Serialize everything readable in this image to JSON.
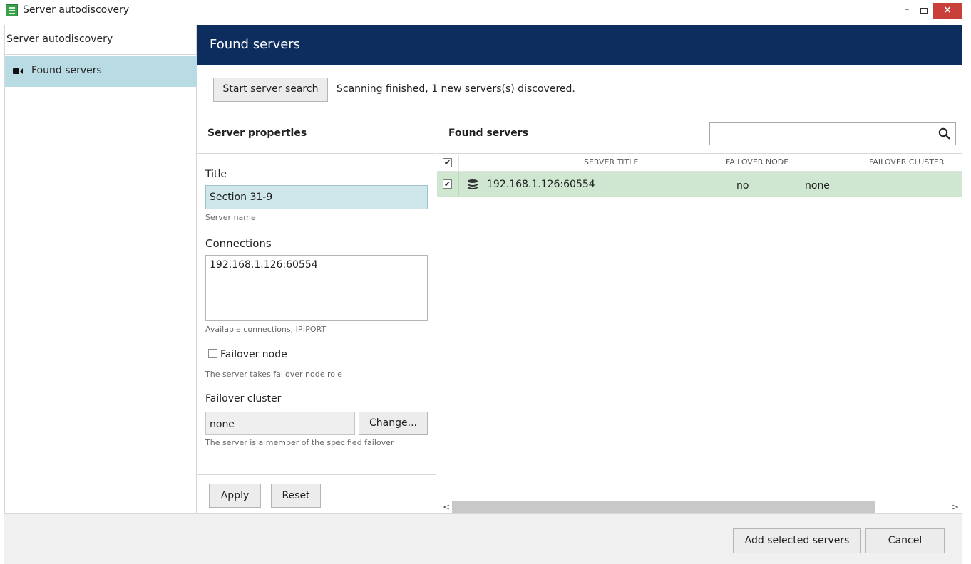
{
  "window": {
    "title": "Server autodiscovery",
    "minimize_label": "–",
    "close_label": "×",
    "close_color": "#c9403a"
  },
  "sidebar": {
    "header": "Server autodiscovery",
    "items": [
      {
        "label": "Found servers",
        "icon": "camera-icon",
        "selected": true
      }
    ]
  },
  "main": {
    "header_title": "Found servers",
    "header_color": "#0d2d5e"
  },
  "toolbar": {
    "start_search_label": "Start server search",
    "status": "Scanning finished, 1 new servers(s) discovered."
  },
  "properties": {
    "header": "Server properties",
    "title_label": "Title",
    "title_value": "Section 31-9",
    "title_hint": "Server name",
    "connections_label": "Connections",
    "connections_value": "192.168.1.126:60554",
    "connections_hint": "Available connections, IP:PORT",
    "failover_node_label": "Failover node",
    "failover_node_checked": false,
    "failover_node_hint": "The server takes failover node role",
    "failover_cluster_label": "Failover cluster",
    "failover_cluster_value": "none",
    "change_label": "Change...",
    "failover_cluster_hint": "The server is a member of the specified failover",
    "apply_label": "Apply",
    "reset_label": "Reset"
  },
  "found_servers": {
    "header": "Found servers",
    "search_value": "",
    "columns": [
      "SERVER TITLE",
      "FAILOVER NODE",
      "FAILOVER CLUSTER"
    ],
    "rows": [
      {
        "checked": true,
        "address": "192.168.1.126:60554",
        "failover_node": "no",
        "failover_cluster": "none",
        "icon": "server-stack-icon"
      }
    ],
    "header_checked": true,
    "selected_row_color": "#cfe7d1"
  },
  "footer": {
    "add_label": "Add selected servers",
    "cancel_label": "Cancel"
  }
}
